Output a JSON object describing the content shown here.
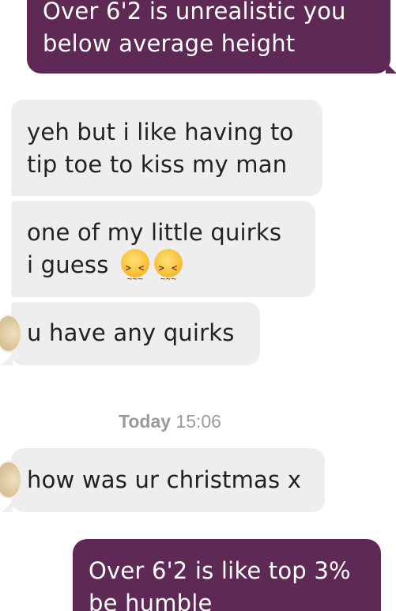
{
  "conversation": {
    "messages": [
      {
        "direction": "outgoing",
        "lines": [
          "Over 6'2 is unrealistic you",
          "below average height"
        ]
      },
      {
        "direction": "incoming",
        "lines": [
          "yeh but i like having to",
          "tip toe to kiss my man"
        ]
      },
      {
        "direction": "incoming",
        "lines": [
          "one of my little quirks",
          "i guess"
        ],
        "emoji": [
          "confounded-face",
          "confounded-face"
        ]
      },
      {
        "direction": "incoming",
        "lines": [
          "u have any quirks"
        ]
      },
      {
        "direction": "incoming",
        "lines": [
          "how was ur christmas x"
        ]
      },
      {
        "direction": "outgoing",
        "lines": [
          "Over 6'2 is like top 3%",
          "be humble"
        ]
      }
    ],
    "timestamp": {
      "day": "Today",
      "time": "15:06"
    }
  },
  "colors": {
    "outgoing_bubble": "#5e2a55",
    "incoming_bubble": "#eeeeee",
    "timestamp_text": "#9a9a9a"
  }
}
